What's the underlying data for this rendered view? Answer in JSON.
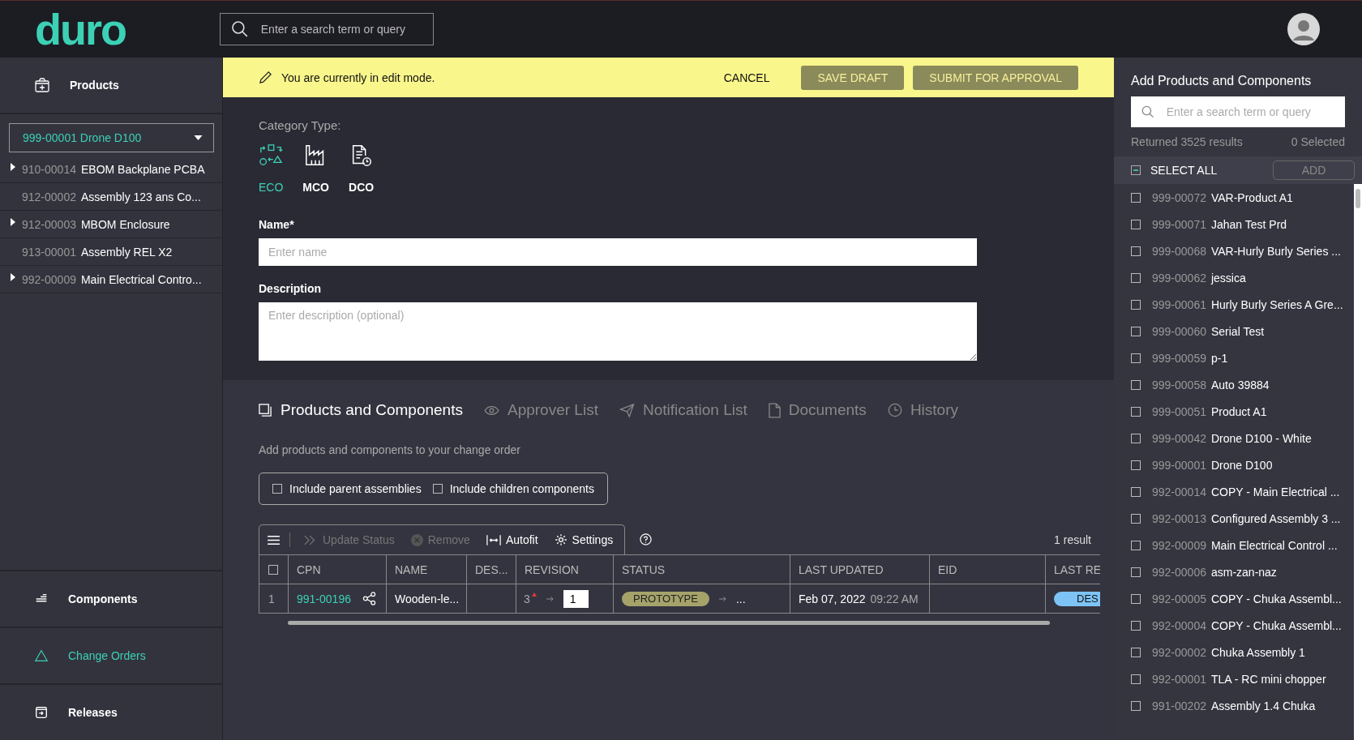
{
  "header": {
    "logo": "duro",
    "search": {
      "placeholder": "Enter a search term or query"
    }
  },
  "sidebar": {
    "nav_top": [
      {
        "label": "Products",
        "kind": "box",
        "selected": false
      }
    ],
    "product_select": {
      "value": "999-00001 Drone D100"
    },
    "tree": [
      {
        "cpn": "910-00014",
        "name": "EBOM Backplane PCBA",
        "expandable": true
      },
      {
        "cpn": "912-00002",
        "name": "Assembly 123 ans Co...",
        "expandable": false
      },
      {
        "cpn": "912-00003",
        "name": "MBOM Enclosure",
        "expandable": true
      },
      {
        "cpn": "913-00001",
        "name": "Assembly REL X2",
        "expandable": false
      },
      {
        "cpn": "992-00009",
        "name": "Main Electrical Contro...",
        "expandable": true
      }
    ],
    "nav_bottom": [
      {
        "label": "Components",
        "kind": "stack",
        "selected": false
      },
      {
        "label": "Change Orders",
        "kind": "triangle",
        "selected": true
      },
      {
        "label": "Releases",
        "kind": "release",
        "selected": false
      }
    ]
  },
  "banner": {
    "message": "You are currently in edit mode.",
    "buttons": [
      {
        "label": "CANCEL",
        "kind": "text"
      },
      {
        "label": "SAVE DRAFT",
        "kind": "primary"
      },
      {
        "label": "SUBMIT FOR APPROVAL",
        "kind": "primary"
      }
    ]
  },
  "form": {
    "category_label": "Category Type:",
    "categories": [
      {
        "label": "ECO",
        "kind": "shapes",
        "selected": true
      },
      {
        "label": "MCO",
        "kind": "factory",
        "selected": false
      },
      {
        "label": "DCO",
        "kind": "doc",
        "selected": false
      }
    ],
    "name": {
      "label": "Name*",
      "placeholder": "Enter name"
    },
    "description": {
      "label": "Description",
      "placeholder": "Enter description (optional)"
    }
  },
  "tabs": [
    {
      "label": "Products and Components",
      "kind": "stack",
      "selected": true
    },
    {
      "label": "Approver List",
      "kind": "eye",
      "selected": false
    },
    {
      "label": "Notification List",
      "kind": "send",
      "selected": false
    },
    {
      "label": "Documents",
      "kind": "doc",
      "selected": false
    },
    {
      "label": "History",
      "kind": "clock",
      "selected": false
    }
  ],
  "subtitle": "Add products and components to your change order",
  "options": [
    {
      "label": "Include parent assemblies",
      "checked": false
    },
    {
      "label": "Include children components",
      "checked": false
    }
  ],
  "toolbar": [
    {
      "label": "Update Status",
      "kind": "chevrons",
      "disabled": true
    },
    {
      "label": "Remove",
      "kind": "remove",
      "disabled": true
    },
    {
      "label": "Autofit",
      "kind": "autofit",
      "disabled": false
    },
    {
      "label": "Settings",
      "kind": "gear",
      "disabled": false
    }
  ],
  "result_count": "1 result",
  "table": {
    "select_all_checked": false,
    "columns": [
      "CPN",
      "NAME",
      "DES...",
      "REVISION",
      "STATUS",
      "LAST UPDATED",
      "EID",
      "LAST RE"
    ],
    "rows": [
      {
        "index": "1",
        "cpn": "991-00196",
        "name": "Wooden-le...",
        "revision": "3",
        "revision_modified": true,
        "new_revision": "1",
        "status": "PROTOTYPE",
        "status_more": "...",
        "updated_date": "Feb 07, 2022",
        "updated_time": "09:22 AM",
        "last_release": "DES"
      }
    ]
  },
  "panel": {
    "title": "Add Products and Components",
    "search": {
      "placeholder": "Enter a search term or query"
    },
    "results": "Returned 3525 results",
    "selected_count": "0 Selected",
    "select_all": "SELECT ALL",
    "add_button": {
      "label": "ADD",
      "disabled": true
    },
    "items": [
      {
        "cpn": "999-00072",
        "name": "VAR-Product A1",
        "checked": false
      },
      {
        "cpn": "999-00071",
        "name": "Jahan Test Prd",
        "checked": false
      },
      {
        "cpn": "999-00068",
        "name": "VAR-Hurly Burly Series ...",
        "checked": false
      },
      {
        "cpn": "999-00062",
        "name": "jessica",
        "checked": false
      },
      {
        "cpn": "999-00061",
        "name": "Hurly Burly Series A Gre...",
        "checked": false
      },
      {
        "cpn": "999-00060",
        "name": "Serial Test",
        "checked": false
      },
      {
        "cpn": "999-00059",
        "name": "p-1",
        "checked": false
      },
      {
        "cpn": "999-00058",
        "name": "Auto 39884",
        "checked": false
      },
      {
        "cpn": "999-00051",
        "name": "Product A1",
        "checked": false
      },
      {
        "cpn": "999-00042",
        "name": "Drone D100 - White",
        "checked": false
      },
      {
        "cpn": "999-00001",
        "name": "Drone D100",
        "checked": false
      },
      {
        "cpn": "992-00014",
        "name": "COPY - Main Electrical ...",
        "checked": false
      },
      {
        "cpn": "992-00013",
        "name": "Configured Assembly 3 ...",
        "checked": false
      },
      {
        "cpn": "992-00009",
        "name": "Main Electrical Control ...",
        "checked": false
      },
      {
        "cpn": "992-00006",
        "name": "asm-zan-naz",
        "checked": false
      },
      {
        "cpn": "992-00005",
        "name": "COPY - Chuka Assembl...",
        "checked": false
      },
      {
        "cpn": "992-00004",
        "name": "COPY - Chuka Assembl...",
        "checked": false
      },
      {
        "cpn": "992-00002",
        "name": "Chuka Assembly 1",
        "checked": false
      },
      {
        "cpn": "992-00001",
        "name": "TLA - RC mini chopper",
        "checked": false
      },
      {
        "cpn": "991-00202",
        "name": "Assembly 1.4 Chuka",
        "checked": false
      }
    ]
  }
}
